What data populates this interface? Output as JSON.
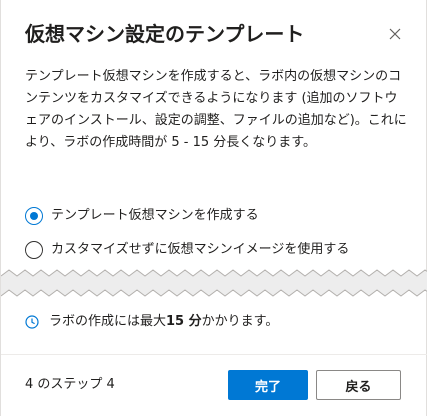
{
  "dialog": {
    "title": "仮想マシン設定のテンプレート",
    "close_icon": "close-icon"
  },
  "description": "テンプレート仮想マシンを作成すると、ラボ内の仮想マシンのコンテンツをカスタマイズできるようになります (追加のソフトウェアのインストール、設定の調整、ファイルの追加など)。これにより、ラボの作成時間が 5 - 15 分長くなります。",
  "options": [
    {
      "label": "テンプレート仮想マシンを作成する",
      "selected": true
    },
    {
      "label": "カスタマイズせずに仮想マシンイメージを使用する",
      "selected": false
    }
  ],
  "info": {
    "icon": "clock-icon",
    "prefix": "ラボの作成には最大 ",
    "bold": "15 分",
    "suffix": " かかります。"
  },
  "footer": {
    "step_text": "4 のステップ 4",
    "finish_label": "完了",
    "back_label": "戻る"
  },
  "colors": {
    "accent": "#0078d4",
    "text": "#201f1e",
    "border": "#8a8886"
  }
}
